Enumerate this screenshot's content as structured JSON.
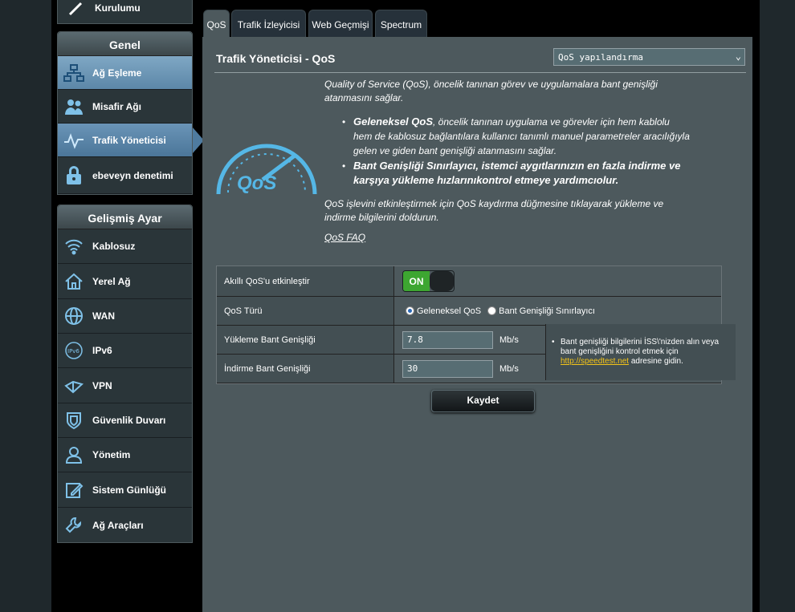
{
  "sidebar": {
    "top_item_label": "Kurulumu",
    "genel_header": "Genel",
    "genel_items": [
      {
        "label": "Ağ Eşleme",
        "icon": "network-map-icon"
      },
      {
        "label": "Misafir Ağı",
        "icon": "guest-network-icon"
      },
      {
        "label": "Trafik Yöneticisi",
        "icon": "traffic-manager-icon"
      },
      {
        "label": "ebeveyn denetimi",
        "icon": "lock-icon"
      }
    ],
    "advanced_header": "Gelişmiş Ayar",
    "advanced_items": [
      {
        "label": "Kablosuz",
        "icon": "wifi-icon"
      },
      {
        "label": "Yerel Ağ",
        "icon": "home-icon"
      },
      {
        "label": "WAN",
        "icon": "globe-icon"
      },
      {
        "label": "IPv6",
        "icon": "ipv6-icon"
      },
      {
        "label": "VPN",
        "icon": "vpn-icon"
      },
      {
        "label": "Güvenlik Duvarı",
        "icon": "shield-icon"
      },
      {
        "label": "Yönetim",
        "icon": "user-icon"
      },
      {
        "label": "Sistem Günlüğü",
        "icon": "log-icon"
      },
      {
        "label": "Ağ Araçları",
        "icon": "tools-icon"
      }
    ]
  },
  "tabs": [
    {
      "label": "QoS"
    },
    {
      "label": "Trafik İzleyicisi"
    },
    {
      "label": "Web Geçmişi"
    },
    {
      "label": "Spectrum"
    }
  ],
  "main": {
    "title": "Trafik Yöneticisi - QoS",
    "select_value": "QoS yapılandırma",
    "intro": "Quality of Service (QoS), öncelik tanınan görev ve uygulamalara bant genişliği atanmasını sağlar.",
    "bullet1_title": "Geleneksel QoS",
    "bullet1_text": ", öncelik tanınan uygulama ve görevler için hem kablolu hem de kablosuz bağlantılara kullanıcı tanımlı manuel parametreler aracılığıyla gelen ve giden bant genişliği atanmasını sağlar.",
    "bullet2": "Bant Genişliği Sınırlayıcı, istemci aygıtlarınızın en fazla indirme ve karşıya yükleme hızlarınıkontrol etmeye yardımcıolur.",
    "instructions": "QoS işlevini etkinleştirmek için QoS kaydırma düğmesine tıklayarak yükleme ve indirme bilgilerini doldurun.",
    "faq_link": "QoS FAQ",
    "logo_text": "QoS"
  },
  "form": {
    "enable_label": "Akıllı QoS'u etkinleştir",
    "toggle_state": "ON",
    "type_label": "QoS Türü",
    "type_options": [
      "Geleneksel QoS",
      "Bant Genişliği Sınırlayıcı"
    ],
    "type_selected": "Geleneksel QoS",
    "upload_label": "Yükleme Bant Genişliği",
    "upload_value": "7.8",
    "download_label": "İndirme Bant Genişliği",
    "download_value": "30",
    "unit": "Mb/s",
    "note_before": "Bant genişliği bilgilerini İSS\\'nizden alın veya bant genişliğini kontrol etmek için ",
    "note_link": "http://speedtest.net",
    "note_after": " adresine gidin.",
    "save": "Kaydet"
  },
  "colors": {
    "content_bg": "#4d595d",
    "active_item": "#5c87a8",
    "toggle_on": "#3da631",
    "link": "#f5c518"
  }
}
